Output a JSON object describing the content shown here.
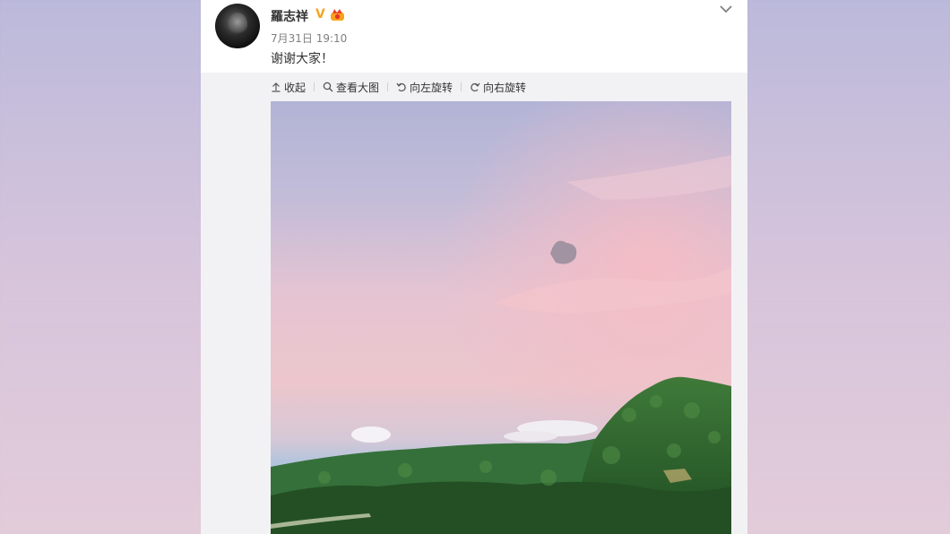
{
  "post": {
    "user_name": "羅志祥",
    "verified_badge": "V",
    "time": "7月31日 19:10",
    "text": "谢谢大家！"
  },
  "toolbar": {
    "collapse": "收起",
    "view_large": "查看大图",
    "rotate_left": "向左旋转",
    "rotate_right": "向右旋转"
  },
  "icons": [
    "collapse-icon",
    "magnifier-icon",
    "rotate-left-icon",
    "rotate-right-icon",
    "chevron-down-icon",
    "crown-icon"
  ],
  "colors": {
    "badge": "#f5a623",
    "sky_top": "#b4b6d8",
    "sky_pink": "#f2c2c8",
    "forest": "#2e6b2e"
  }
}
